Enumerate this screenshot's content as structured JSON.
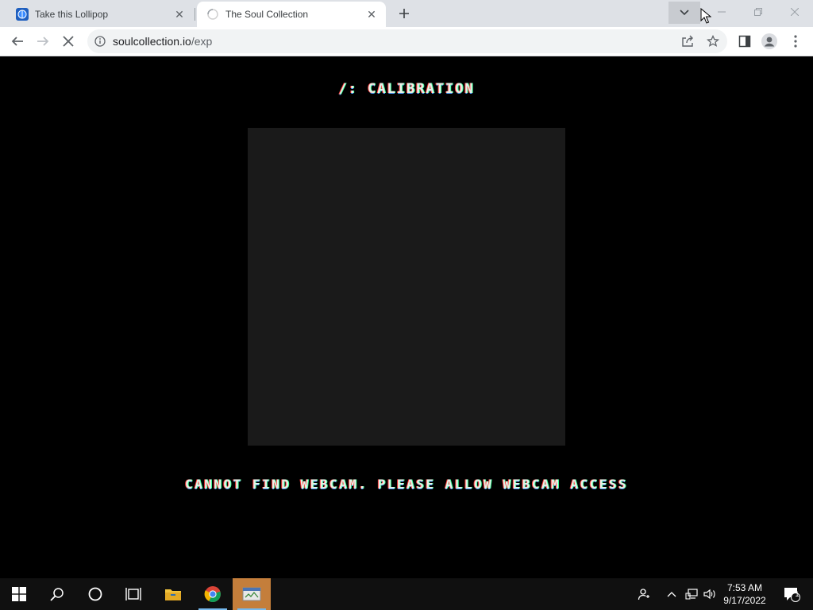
{
  "browser": {
    "tabs": [
      {
        "title": "Take this Lollipop",
        "active": false,
        "icon": "lollipop-favicon"
      },
      {
        "title": "The Soul Collection",
        "active": true,
        "icon": "loading-spinner-icon"
      }
    ],
    "url": {
      "host": "soulcollection.io",
      "path": "/exp"
    }
  },
  "page": {
    "heading": "/: CALIBRATION",
    "error_message": "CANNOT FIND WEBCAM. PLEASE ALLOW WEBCAM ACCESS",
    "webcam_box_color": "#1a1a1a"
  },
  "taskbar": {
    "time": "7:53 AM",
    "date": "9/17/2022",
    "notification_count": "1"
  },
  "colors": {
    "tabstrip": "#dee1e6",
    "accent": "#1a73e8",
    "page_background": "#000000"
  }
}
